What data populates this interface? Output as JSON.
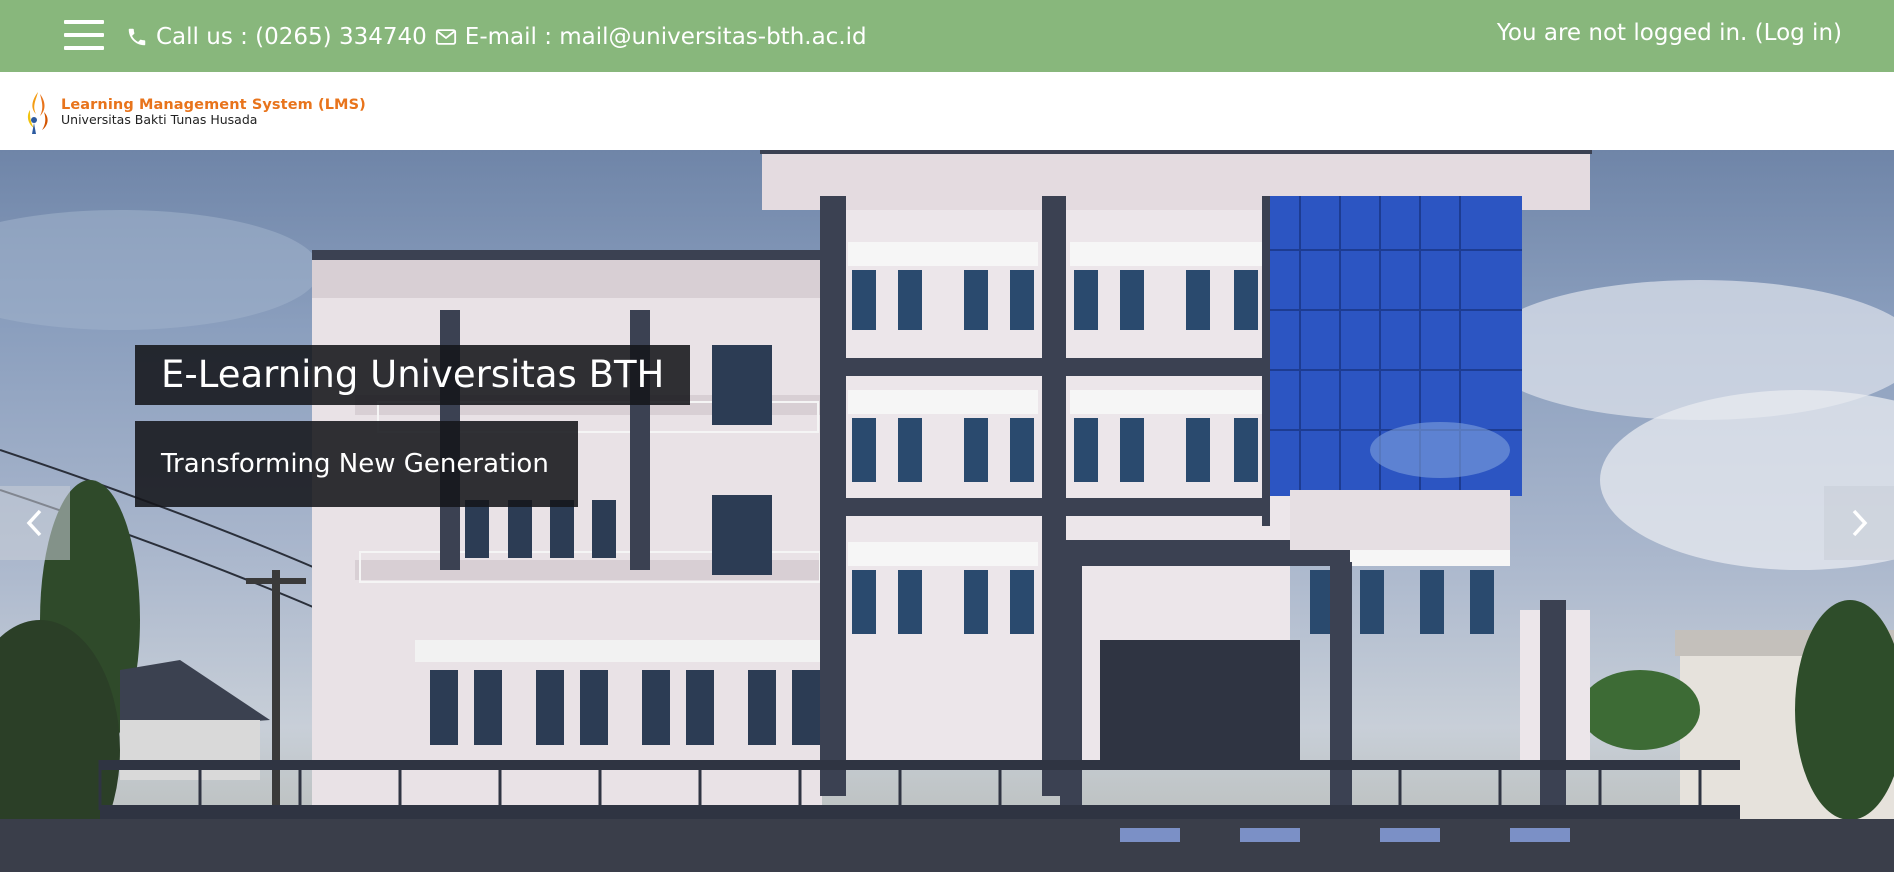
{
  "topbar": {
    "background": "#88b77c",
    "phone_icon": "phone-icon",
    "phone_text": "Call us : (0265) 334740",
    "email_icon": "envelope-icon",
    "email_text": "E-mail : mail@universitas-bth.ac.id",
    "login_prefix": "You are not logged in. (",
    "login_link": "Log in",
    "login_suffix": ")"
  },
  "header": {
    "logo_title": "Learning Management System (LMS)",
    "logo_subtitle": "Universitas Bakti Tunas Husada",
    "logo_accent": "#e8741c"
  },
  "hero": {
    "title": "E-Learning Universitas BTH",
    "subtitle": "Transforming New Generation",
    "prev_icon": "chevron-left-icon",
    "next_icon": "chevron-right-icon"
  }
}
